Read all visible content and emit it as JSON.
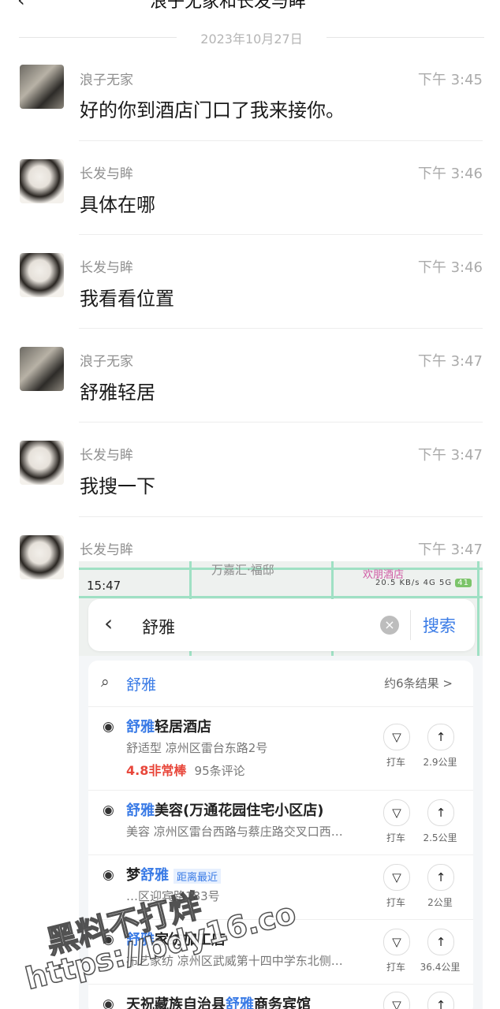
{
  "header": {
    "back_icon": "chevron-left-icon",
    "title": "浪子无家和长发与眸"
  },
  "date_divider": "2023年10月27日",
  "messages": [
    {
      "sender": "浪子无家",
      "time": "下午 3:45",
      "text": "好的你到酒店门口了我来接你。"
    },
    {
      "sender": "长发与眸",
      "time": "下午 3:46",
      "text": "具体在哪"
    },
    {
      "sender": "长发与眸",
      "time": "下午 3:46",
      "text": "我看看位置"
    },
    {
      "sender": "浪子无家",
      "time": "下午 3:47",
      "text": "舒雅轻居"
    },
    {
      "sender": "长发与眸",
      "time": "下午 3:47",
      "text": "我搜一下"
    },
    {
      "sender": "长发与眸",
      "time": "下午 3:47",
      "text": ""
    }
  ],
  "screenshot": {
    "map_labels": [
      "万嘉汇·福邸",
      "欢朋酒店"
    ],
    "status_time": "15:47",
    "status_info": "20.5 KB/s  4G  5G",
    "battery": "41",
    "search": {
      "query": "舒雅",
      "search_button": "搜索"
    },
    "results_header": {
      "keyword": "舒雅",
      "count": "约6条结果 >"
    },
    "results": [
      {
        "name_hl": "舒雅",
        "name_rest": "轻居酒店",
        "name_pre": "",
        "tag": "",
        "sub": "舒适型  凉州区雷台东路2号",
        "score": "4.8非常棒",
        "reviews": "95条评论",
        "taxi": "打车",
        "distance": "2.9公里"
      },
      {
        "name_hl": "舒雅",
        "name_rest": "美容(万通花园住宅小区店)",
        "name_pre": "",
        "tag": "",
        "sub": "美容  凉州区雷台西路与蔡庄路交叉口西…",
        "score": "",
        "reviews": "",
        "taxi": "打车",
        "distance": "2.5公里"
      },
      {
        "name_hl": "舒雅",
        "name_rest": "",
        "name_pre": "梦",
        "tag": "距离最近",
        "sub": "…区迎宾路183号",
        "score": "",
        "reviews": "",
        "taxi": "打车",
        "distance": "2公里"
      },
      {
        "name_hl": "舒雅",
        "name_rest": "家纺加工店",
        "name_pre": "",
        "tag": "",
        "sub": "布艺家纺  凉州区武威第十四中学东北侧…",
        "score": "",
        "reviews": "",
        "taxi": "打车",
        "distance": "36.4公里"
      },
      {
        "name_hl": "舒雅",
        "name_rest": "商务宾馆",
        "name_pre": "天祝藏族自治县",
        "tag": "",
        "sub": "",
        "score": "",
        "reviews": "",
        "taxi": "",
        "distance": ""
      }
    ]
  },
  "watermark": {
    "line1": "黑料不打烊",
    "line2": "https://bdy16.co"
  }
}
